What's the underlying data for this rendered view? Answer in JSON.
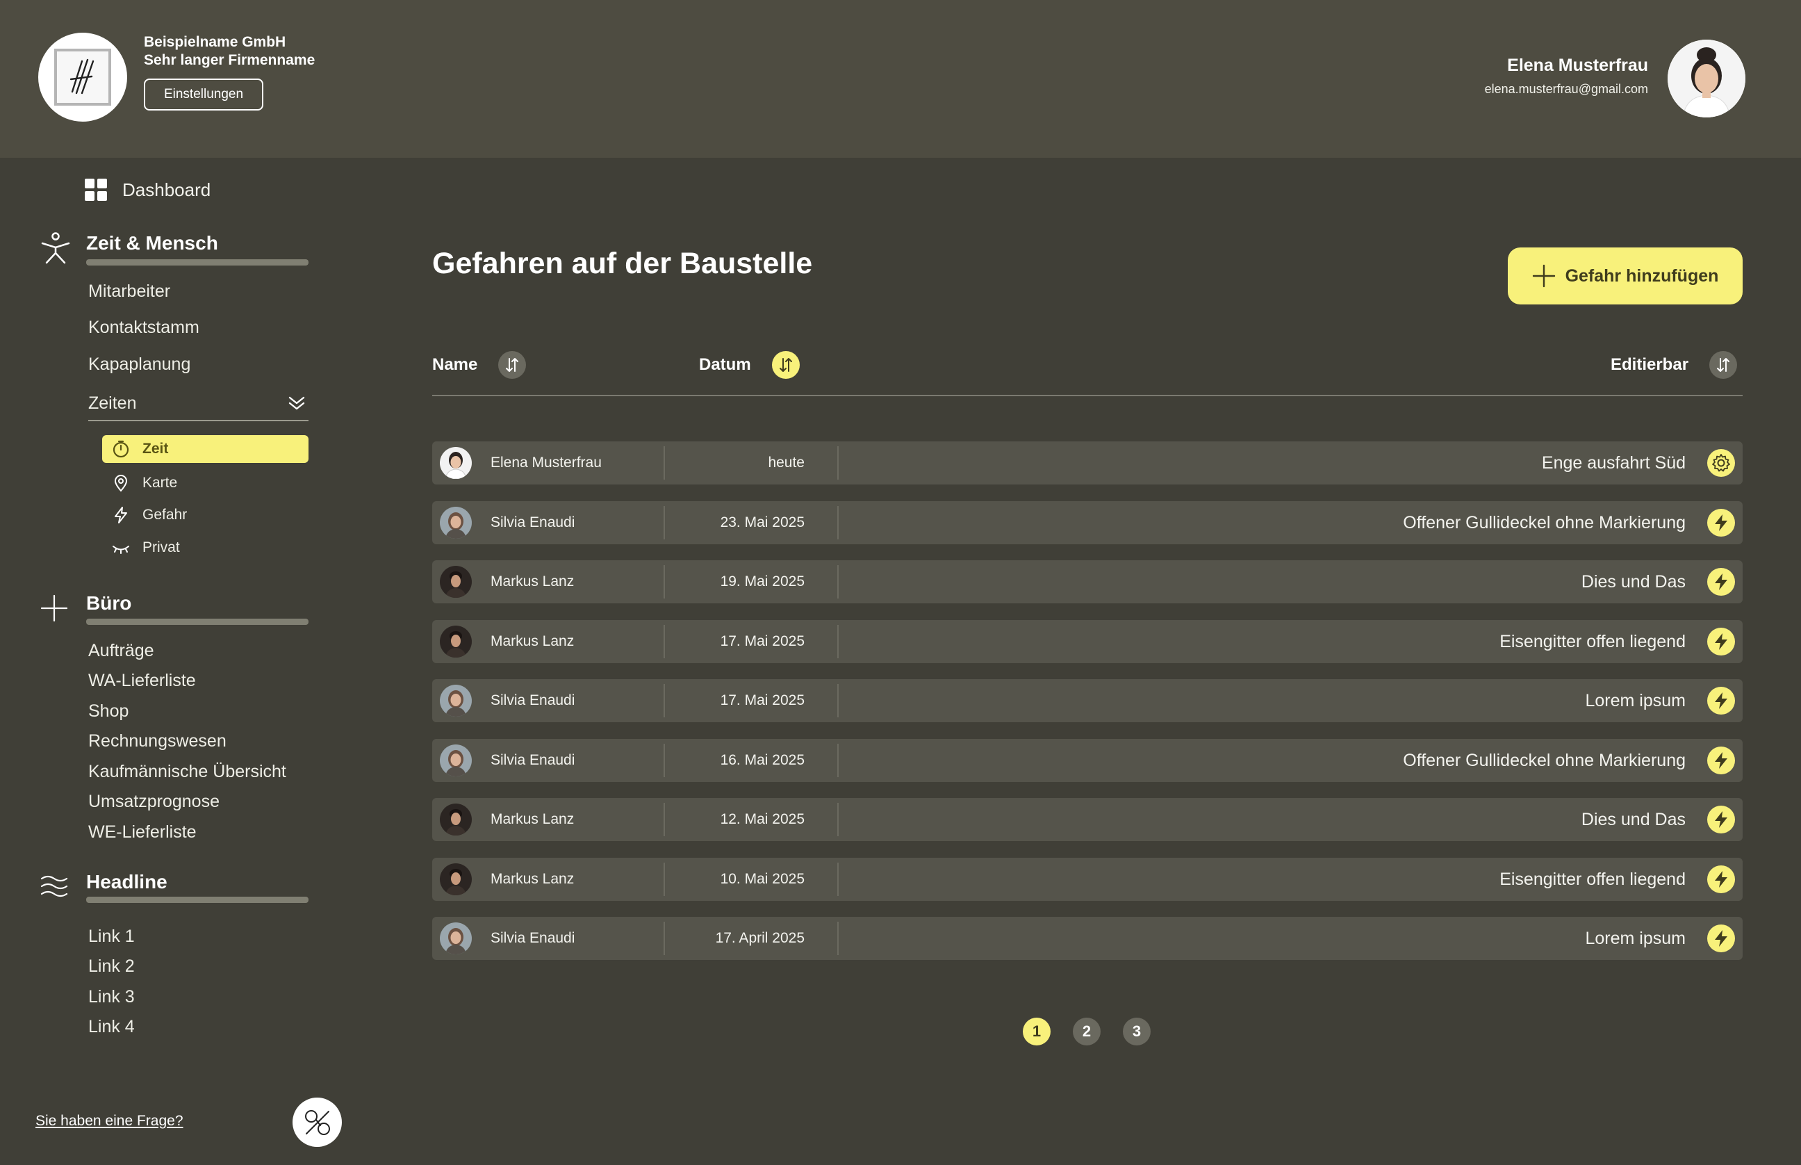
{
  "header": {
    "company_line1": "Beispielname GmbH",
    "company_line2": "Sehr langer Firmenname",
    "settings_label": "Einstellungen",
    "user_name": "Elena Musterfrau",
    "user_email": "elena.musterfrau@gmail.com"
  },
  "sidebar": {
    "dashboard": "Dashboard",
    "section1": {
      "title": "Zeit & Mensch",
      "links": [
        "Mitarbeiter",
        "Kontaktstamm",
        "Kapaplanung"
      ],
      "zeiten": "Zeiten",
      "sub": [
        "Zeit",
        "Karte",
        "Gefahr",
        "Privat"
      ]
    },
    "section2": {
      "title": "Büro",
      "links": [
        "Aufträge",
        "WA-Lieferliste",
        "Shop",
        "Rechnungswesen",
        "Kaufmännische Übersicht",
        "Umsatzprognose",
        "WE-Lieferliste"
      ]
    },
    "section3": {
      "title": "Headline",
      "links": [
        "Link 1",
        "Link 2",
        "Link 3",
        "Link 4"
      ]
    },
    "question": "Sie haben eine Frage?"
  },
  "main": {
    "title": "Gefahren auf der Baustelle",
    "add_label": "Gefahr hinzufügen",
    "columns": {
      "name": "Name",
      "date": "Datum",
      "editable": "Editierbar"
    },
    "rows": [
      {
        "name": "Elena Musterfrau",
        "date": "heute",
        "desc": "Enge ausfahrt Süd",
        "action": "gear-icon"
      },
      {
        "name": "Silvia Enaudi",
        "date": "23. Mai 2025",
        "desc": "Offener Gullideckel ohne Markierung",
        "action": "bolt-icon"
      },
      {
        "name": "Markus Lanz",
        "date": "19. Mai 2025",
        "desc": "Dies und Das",
        "action": "bolt-icon"
      },
      {
        "name": "Markus Lanz",
        "date": "17. Mai 2025",
        "desc": "Eisengitter offen liegend",
        "action": "bolt-icon"
      },
      {
        "name": "Silvia Enaudi",
        "date": "17. Mai 2025",
        "desc": "Lorem ipsum",
        "action": "bolt-icon"
      },
      {
        "name": "Silvia Enaudi",
        "date": "16. Mai 2025",
        "desc": "Offener Gullideckel ohne Markierung",
        "action": "bolt-icon"
      },
      {
        "name": "Markus Lanz",
        "date": "12. Mai 2025",
        "desc": "Dies und Das",
        "action": "bolt-icon"
      },
      {
        "name": "Markus Lanz",
        "date": "10. Mai 2025",
        "desc": "Eisengitter offen liegend",
        "action": "bolt-icon"
      },
      {
        "name": "Silvia Enaudi",
        "date": "17. April 2025",
        "desc": "Lorem ipsum",
        "action": "bolt-icon"
      }
    ],
    "pages": [
      "1",
      "2",
      "3"
    ],
    "active_page": "1"
  },
  "colors": {
    "accent": "#f8f17b",
    "header_bg": "#4e4c41",
    "body_bg": "#403f37",
    "row_bg": "#55544b"
  }
}
